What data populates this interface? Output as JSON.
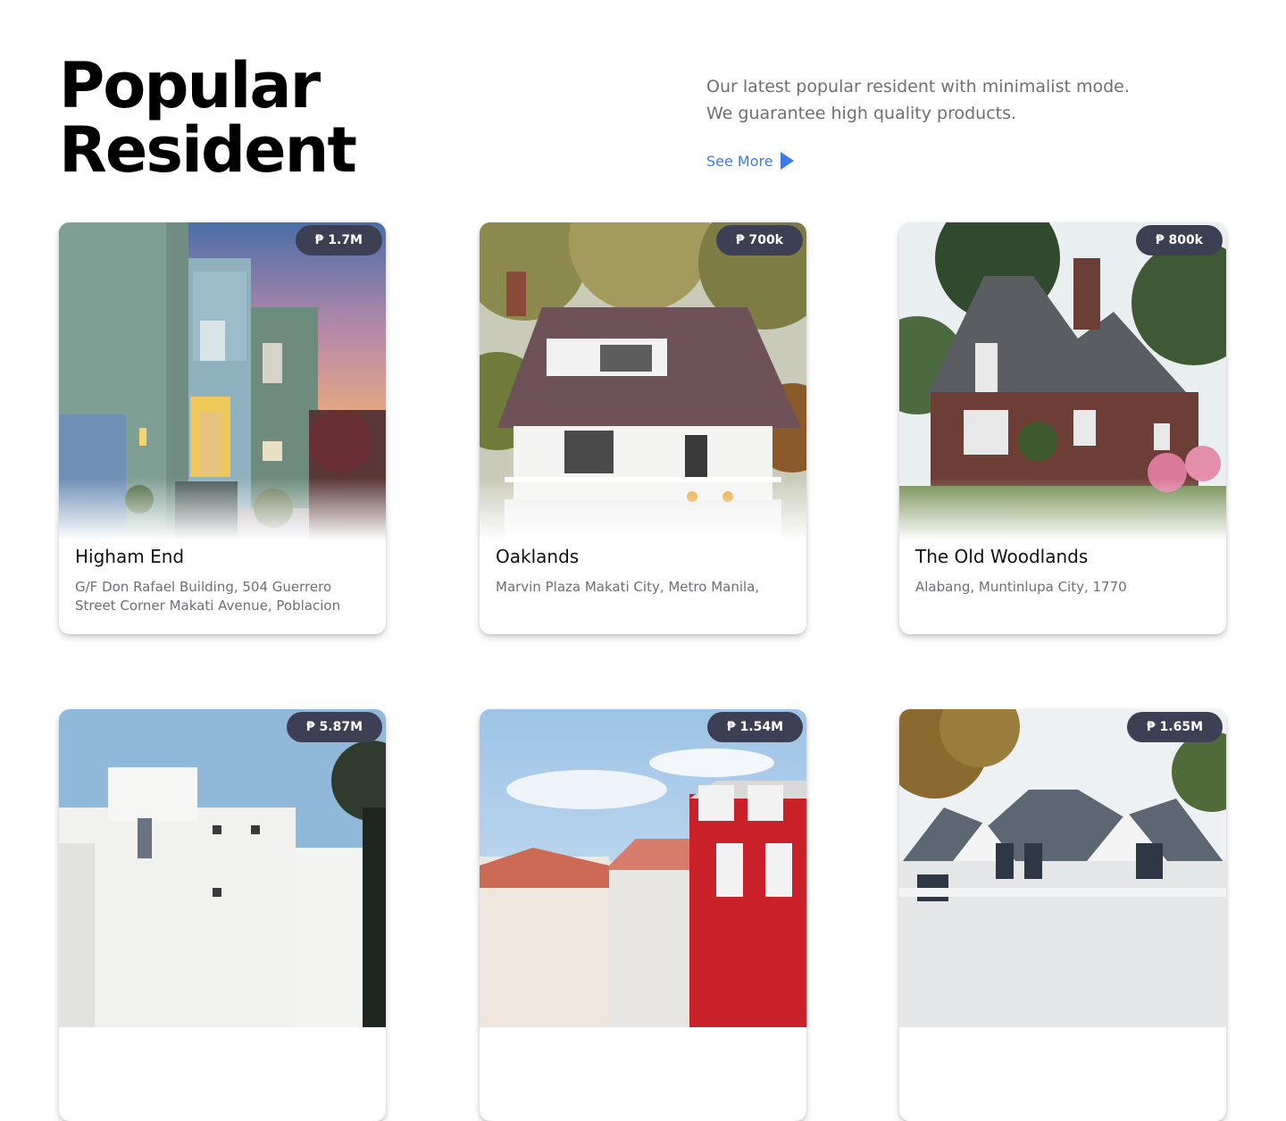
{
  "header": {
    "title_line1": "Popular",
    "title_line2": "Resident",
    "description_line1": "Our latest popular resident with minimalist mode.",
    "description_line2": "We guarantee high quality products.",
    "see_more_label": "See More",
    "see_more_icon": "play-arrow-icon"
  },
  "colors": {
    "accent": "#3b7be8",
    "price_badge": "#3d3f54",
    "text_muted": "#6b6f79"
  },
  "listings": [
    {
      "price": "₱ 1.7M",
      "name": "Higham End",
      "address": "G/F Don Rafael Building, 504 Guerrero Street Corner Makati Avenue, Poblacion"
    },
    {
      "price": "₱ 700k",
      "name": "Oaklands",
      "address": "Marvin Plaza Makati City, Metro Manila,"
    },
    {
      "price": "₱ 800k",
      "name": "The Old Woodlands",
      "address": "Alabang, Muntinlupa City, 1770"
    },
    {
      "price": "₱ 5.87M"
    },
    {
      "price": "₱ 1.54M"
    },
    {
      "price": "₱ 1.65M"
    }
  ]
}
